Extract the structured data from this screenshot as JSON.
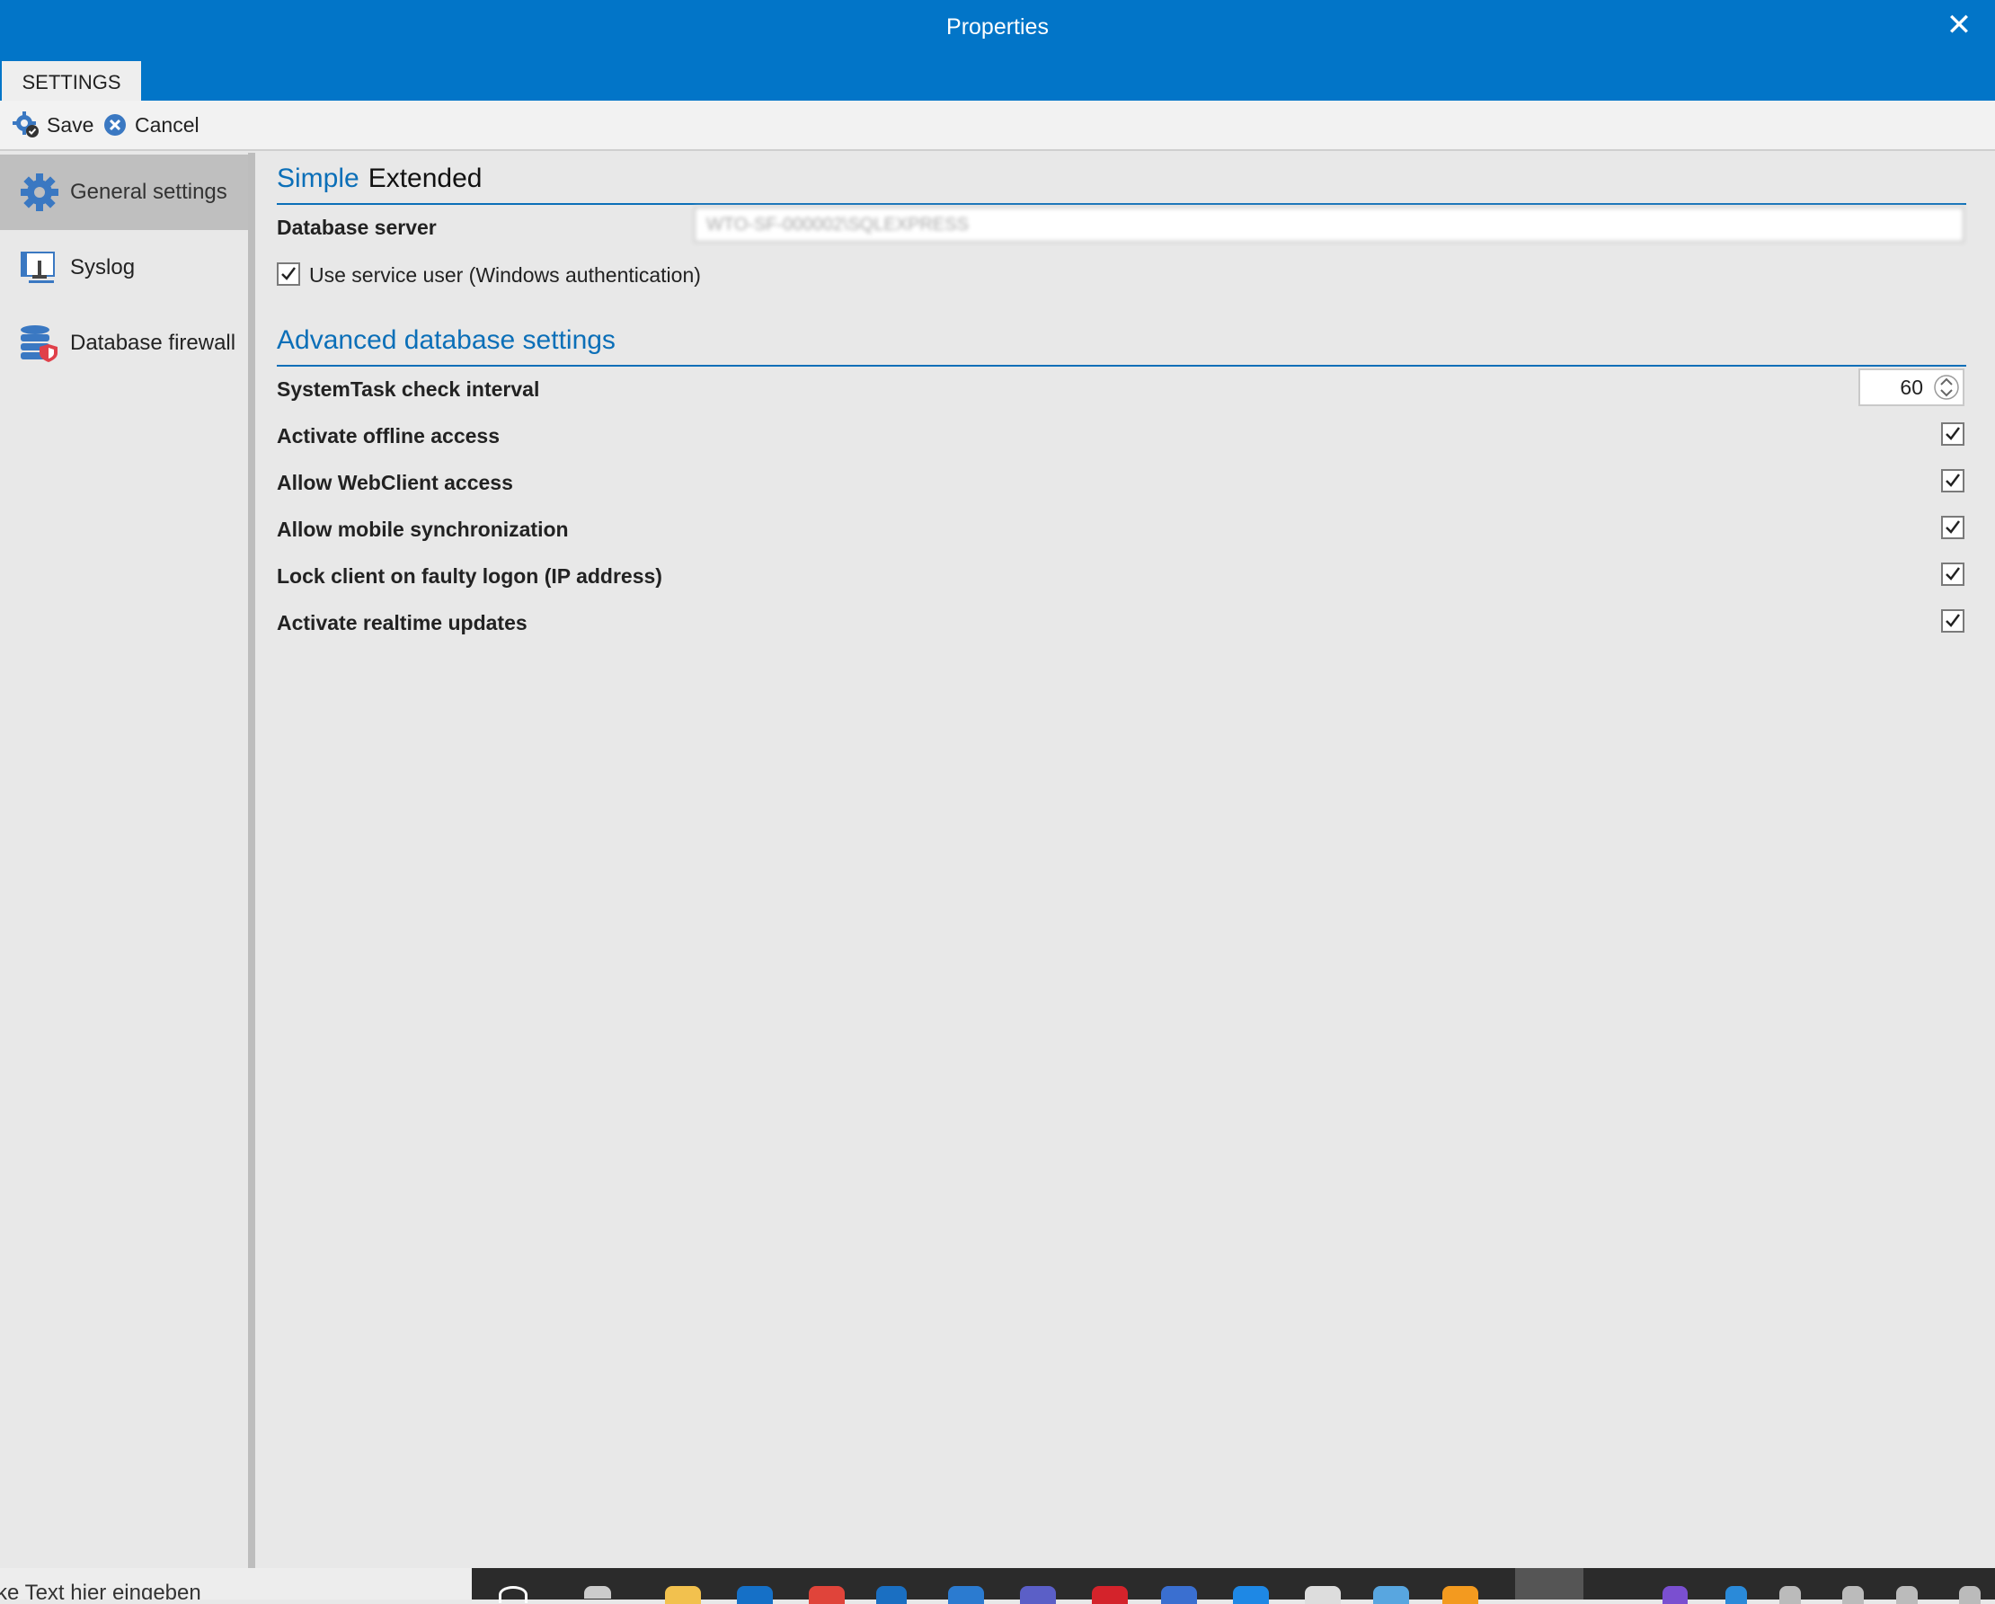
{
  "window": {
    "title": "Properties",
    "close_icon": "close-icon"
  },
  "tabs": [
    {
      "label": "SETTINGS"
    }
  ],
  "toolbar": {
    "save_label": "Save",
    "cancel_label": "Cancel"
  },
  "sidebar": {
    "items": [
      {
        "label": "General settings",
        "icon": "gear-icon",
        "active": true
      },
      {
        "label": "Syslog",
        "icon": "syslog-icon",
        "active": false
      },
      {
        "label": "Database firewall",
        "icon": "database-shield-icon",
        "active": false
      }
    ]
  },
  "main": {
    "subtabs": [
      {
        "label": "Simple",
        "active": true
      },
      {
        "label": "Extended",
        "active": false
      }
    ],
    "database_server": {
      "label": "Database server",
      "value": "WTO-SF-000002\\SQLEXPRESS"
    },
    "use_service_user": {
      "label": "Use service user (Windows authentication)",
      "checked": true
    },
    "advanced": {
      "title": "Advanced database settings",
      "systemtask_interval": {
        "label": "SystemTask check interval",
        "value": "60"
      },
      "options": [
        {
          "label": "Activate offline access",
          "checked": true
        },
        {
          "label": "Allow WebClient access",
          "checked": true
        },
        {
          "label": "Allow mobile synchronization",
          "checked": true
        },
        {
          "label": "Lock client on faulty logon (IP address)",
          "checked": true
        },
        {
          "label": "Activate realtime updates",
          "checked": true
        }
      ]
    }
  },
  "taskbar": {
    "search_text": "ke Text hier eingeben"
  },
  "colors": {
    "accent": "#0275c8",
    "link": "#0b6fb8",
    "background": "#e8e8e8"
  }
}
